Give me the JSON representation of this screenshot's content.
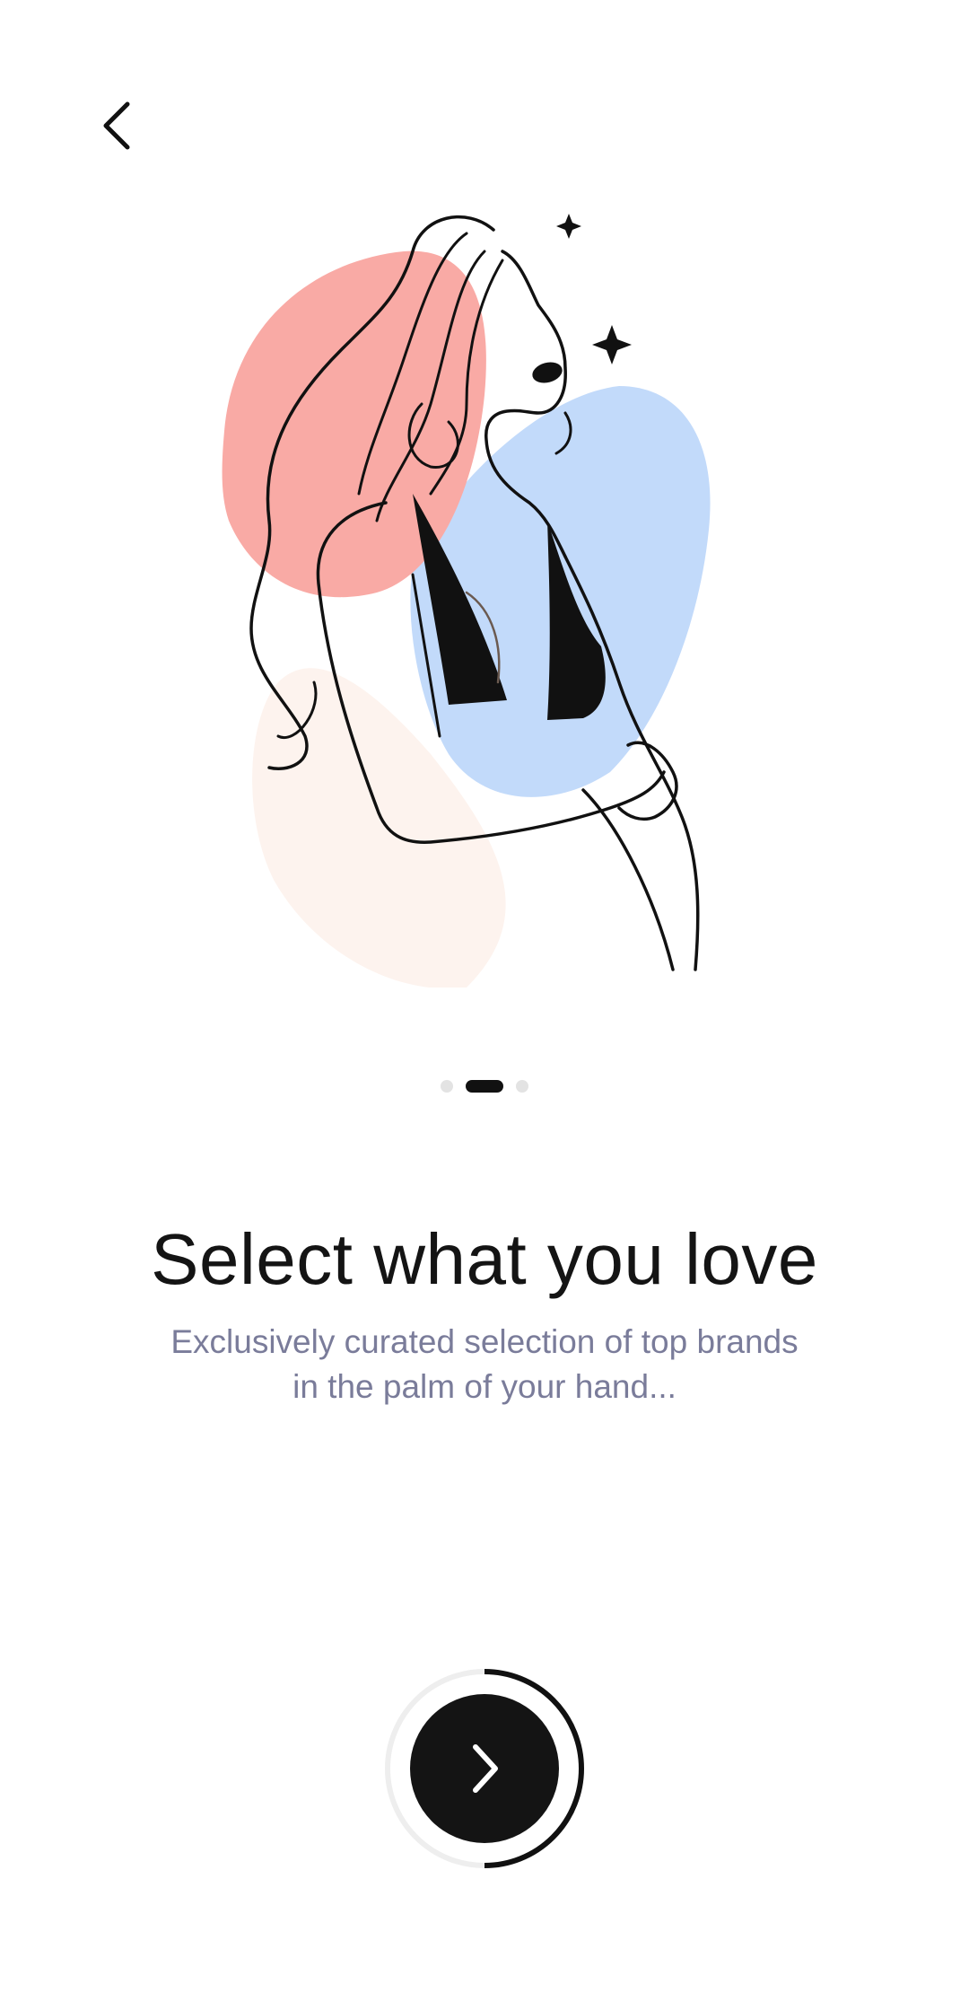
{
  "header": {
    "back_icon": "chevron-left-icon"
  },
  "illustration": {
    "subject": "woman-line-art-illustration",
    "colors": {
      "pink_blob": "#f9aaa5",
      "blue_blob": "#c2dafa",
      "peach_blob": "#fdf3ee",
      "line": "#111111"
    }
  },
  "pager": {
    "count": 3,
    "active_index": 1
  },
  "content": {
    "title": "Select what you love",
    "subtitle": "Exclusively curated selection of top brands in the palm of your hand..."
  },
  "next": {
    "icon": "chevron-right-icon",
    "progress": 0.5,
    "colors": {
      "button": "#141414",
      "ring_track": "#eeeeee",
      "ring_progress": "#111111"
    }
  }
}
